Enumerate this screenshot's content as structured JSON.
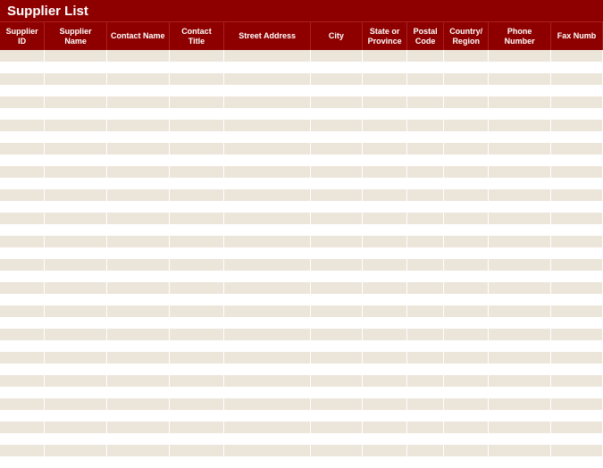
{
  "title": "Supplier List",
  "columns": [
    "Supplier ID",
    "Supplier Name",
    "Contact Name",
    "Contact Title",
    "Street Address",
    "City",
    "State or Province",
    "Postal Code",
    "Country/ Region",
    "Phone Number",
    "Fax Numb"
  ],
  "row_count": 36
}
